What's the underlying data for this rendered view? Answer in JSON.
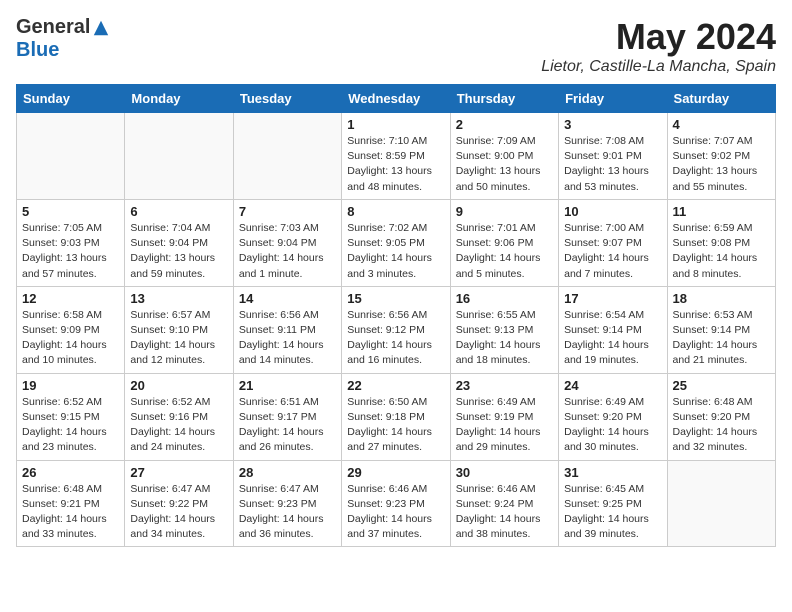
{
  "header": {
    "logo_general": "General",
    "logo_blue": "Blue",
    "title": "May 2024",
    "subtitle": "Lietor, Castille-La Mancha, Spain"
  },
  "days_of_week": [
    "Sunday",
    "Monday",
    "Tuesday",
    "Wednesday",
    "Thursday",
    "Friday",
    "Saturday"
  ],
  "weeks": [
    [
      {
        "day": "",
        "info": ""
      },
      {
        "day": "",
        "info": ""
      },
      {
        "day": "",
        "info": ""
      },
      {
        "day": "1",
        "info": "Sunrise: 7:10 AM\nSunset: 8:59 PM\nDaylight: 13 hours\nand 48 minutes."
      },
      {
        "day": "2",
        "info": "Sunrise: 7:09 AM\nSunset: 9:00 PM\nDaylight: 13 hours\nand 50 minutes."
      },
      {
        "day": "3",
        "info": "Sunrise: 7:08 AM\nSunset: 9:01 PM\nDaylight: 13 hours\nand 53 minutes."
      },
      {
        "day": "4",
        "info": "Sunrise: 7:07 AM\nSunset: 9:02 PM\nDaylight: 13 hours\nand 55 minutes."
      }
    ],
    [
      {
        "day": "5",
        "info": "Sunrise: 7:05 AM\nSunset: 9:03 PM\nDaylight: 13 hours\nand 57 minutes."
      },
      {
        "day": "6",
        "info": "Sunrise: 7:04 AM\nSunset: 9:04 PM\nDaylight: 13 hours\nand 59 minutes."
      },
      {
        "day": "7",
        "info": "Sunrise: 7:03 AM\nSunset: 9:04 PM\nDaylight: 14 hours\nand 1 minute."
      },
      {
        "day": "8",
        "info": "Sunrise: 7:02 AM\nSunset: 9:05 PM\nDaylight: 14 hours\nand 3 minutes."
      },
      {
        "day": "9",
        "info": "Sunrise: 7:01 AM\nSunset: 9:06 PM\nDaylight: 14 hours\nand 5 minutes."
      },
      {
        "day": "10",
        "info": "Sunrise: 7:00 AM\nSunset: 9:07 PM\nDaylight: 14 hours\nand 7 minutes."
      },
      {
        "day": "11",
        "info": "Sunrise: 6:59 AM\nSunset: 9:08 PM\nDaylight: 14 hours\nand 8 minutes."
      }
    ],
    [
      {
        "day": "12",
        "info": "Sunrise: 6:58 AM\nSunset: 9:09 PM\nDaylight: 14 hours\nand 10 minutes."
      },
      {
        "day": "13",
        "info": "Sunrise: 6:57 AM\nSunset: 9:10 PM\nDaylight: 14 hours\nand 12 minutes."
      },
      {
        "day": "14",
        "info": "Sunrise: 6:56 AM\nSunset: 9:11 PM\nDaylight: 14 hours\nand 14 minutes."
      },
      {
        "day": "15",
        "info": "Sunrise: 6:56 AM\nSunset: 9:12 PM\nDaylight: 14 hours\nand 16 minutes."
      },
      {
        "day": "16",
        "info": "Sunrise: 6:55 AM\nSunset: 9:13 PM\nDaylight: 14 hours\nand 18 minutes."
      },
      {
        "day": "17",
        "info": "Sunrise: 6:54 AM\nSunset: 9:14 PM\nDaylight: 14 hours\nand 19 minutes."
      },
      {
        "day": "18",
        "info": "Sunrise: 6:53 AM\nSunset: 9:14 PM\nDaylight: 14 hours\nand 21 minutes."
      }
    ],
    [
      {
        "day": "19",
        "info": "Sunrise: 6:52 AM\nSunset: 9:15 PM\nDaylight: 14 hours\nand 23 minutes."
      },
      {
        "day": "20",
        "info": "Sunrise: 6:52 AM\nSunset: 9:16 PM\nDaylight: 14 hours\nand 24 minutes."
      },
      {
        "day": "21",
        "info": "Sunrise: 6:51 AM\nSunset: 9:17 PM\nDaylight: 14 hours\nand 26 minutes."
      },
      {
        "day": "22",
        "info": "Sunrise: 6:50 AM\nSunset: 9:18 PM\nDaylight: 14 hours\nand 27 minutes."
      },
      {
        "day": "23",
        "info": "Sunrise: 6:49 AM\nSunset: 9:19 PM\nDaylight: 14 hours\nand 29 minutes."
      },
      {
        "day": "24",
        "info": "Sunrise: 6:49 AM\nSunset: 9:20 PM\nDaylight: 14 hours\nand 30 minutes."
      },
      {
        "day": "25",
        "info": "Sunrise: 6:48 AM\nSunset: 9:20 PM\nDaylight: 14 hours\nand 32 minutes."
      }
    ],
    [
      {
        "day": "26",
        "info": "Sunrise: 6:48 AM\nSunset: 9:21 PM\nDaylight: 14 hours\nand 33 minutes."
      },
      {
        "day": "27",
        "info": "Sunrise: 6:47 AM\nSunset: 9:22 PM\nDaylight: 14 hours\nand 34 minutes."
      },
      {
        "day": "28",
        "info": "Sunrise: 6:47 AM\nSunset: 9:23 PM\nDaylight: 14 hours\nand 36 minutes."
      },
      {
        "day": "29",
        "info": "Sunrise: 6:46 AM\nSunset: 9:23 PM\nDaylight: 14 hours\nand 37 minutes."
      },
      {
        "day": "30",
        "info": "Sunrise: 6:46 AM\nSunset: 9:24 PM\nDaylight: 14 hours\nand 38 minutes."
      },
      {
        "day": "31",
        "info": "Sunrise: 6:45 AM\nSunset: 9:25 PM\nDaylight: 14 hours\nand 39 minutes."
      },
      {
        "day": "",
        "info": ""
      }
    ]
  ]
}
